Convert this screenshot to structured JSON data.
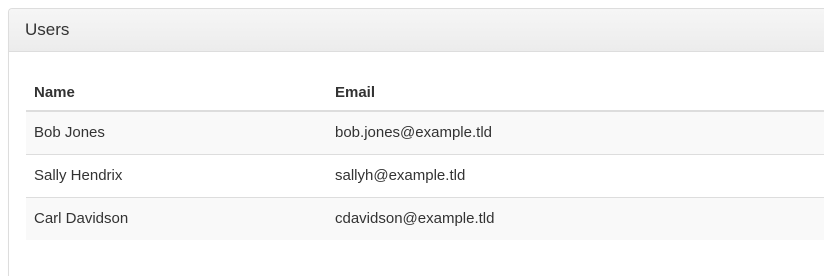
{
  "panel": {
    "title": "Users"
  },
  "table": {
    "headers": {
      "name": "Name",
      "email": "Email"
    },
    "rows": [
      {
        "name": "Bob Jones",
        "email": "bob.jones@example.tld"
      },
      {
        "name": "Sally Hendrix",
        "email": "sallyh@example.tld"
      },
      {
        "name": "Carl Davidson",
        "email": "cdavidson@example.tld"
      }
    ]
  }
}
